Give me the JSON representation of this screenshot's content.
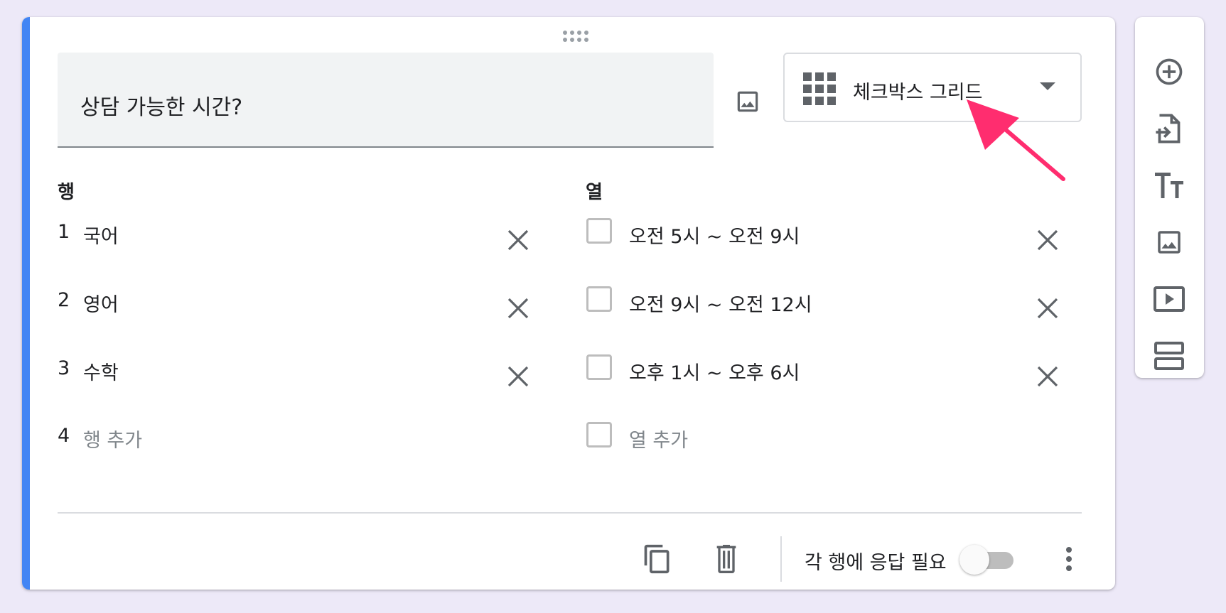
{
  "question": {
    "title": "상담 가능한 시간?",
    "type_label": "체크박스 그리드"
  },
  "rows": {
    "header": "행",
    "items": [
      {
        "num": "1",
        "label": "국어"
      },
      {
        "num": "2",
        "label": "영어"
      },
      {
        "num": "3",
        "label": "수학"
      }
    ],
    "add_num": "4",
    "add_label": "행 추가"
  },
  "columns": {
    "header": "열",
    "items": [
      {
        "label": "오전 5시 ~ 오전 9시"
      },
      {
        "label": "오전 9시 ~ 오전 12시"
      },
      {
        "label": "오후 1시 ~ 오후 6시"
      }
    ],
    "add_label": "열 추가"
  },
  "footer": {
    "required_label": "각 행에 응답 필요",
    "required_on": false
  },
  "colors": {
    "accent": "#4285f4",
    "annotation_arrow": "#ff2d6f",
    "background": "#ede9f8"
  },
  "icons": {
    "header": [
      "drag-handle-icon",
      "image-icon",
      "grid-icon",
      "dropdown-caret-icon"
    ],
    "footer": [
      "copy-icon",
      "trash-icon",
      "more-vert-icon"
    ],
    "toolbar": [
      "add-circle-icon",
      "import-icon",
      "title-text-icon",
      "image-icon",
      "video-icon",
      "section-icon"
    ]
  }
}
